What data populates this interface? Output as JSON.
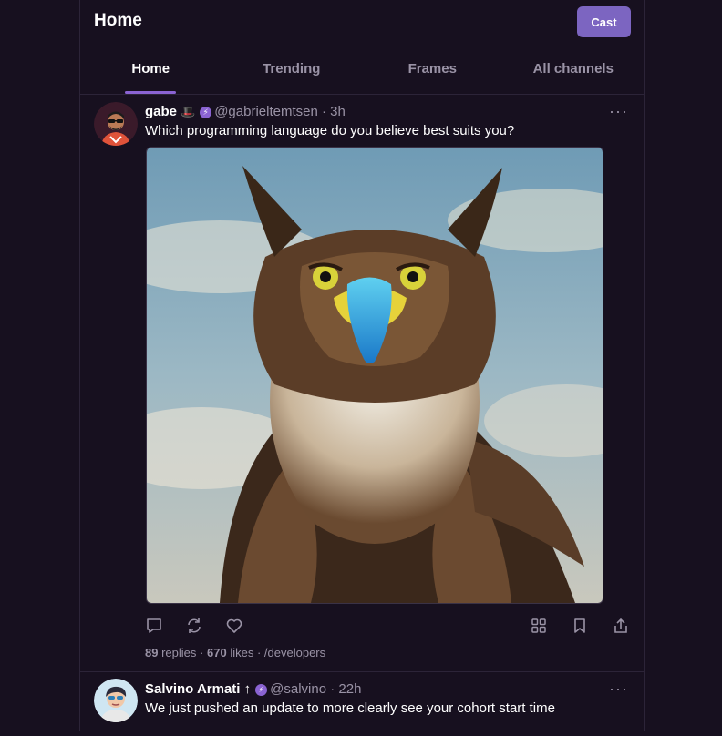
{
  "header": {
    "title": "Home",
    "cast_label": "Cast",
    "tabs": [
      {
        "label": "Home",
        "active": true
      },
      {
        "label": "Trending",
        "active": false
      },
      {
        "label": "Frames",
        "active": false
      },
      {
        "label": "All channels",
        "active": false
      }
    ]
  },
  "casts": [
    {
      "display_name": "gabe",
      "badge_icon": "top-hat-emoji",
      "verified_icon": "power-badge-icon",
      "username": "@gabrieltemtsen",
      "separator": "·",
      "time": "3h",
      "text": "Which programming language do you believe best suits you?",
      "more_icon": "···",
      "image_subject": "eagle",
      "actions": [
        "reply-icon",
        "recast-icon",
        "like-icon",
        "grid-icon",
        "bookmark-icon",
        "share-icon"
      ],
      "stats": {
        "replies_count": "89",
        "replies_label": "replies",
        "dot": "·",
        "likes_count": "670",
        "likes_label": "likes",
        "channel": "/developers"
      }
    },
    {
      "display_name": "Salvino Armati",
      "badge_icon": "↑",
      "verified_icon": "power-badge-icon",
      "username": "@salvino",
      "separator": "·",
      "time": "22h",
      "text": "We just pushed an update to more clearly see your cohort start time",
      "more_icon": "···"
    }
  ],
  "colors": {
    "background": "#17101f",
    "accent": "#7c65c1",
    "muted": "#9a93a6",
    "divider": "#2c2438"
  }
}
